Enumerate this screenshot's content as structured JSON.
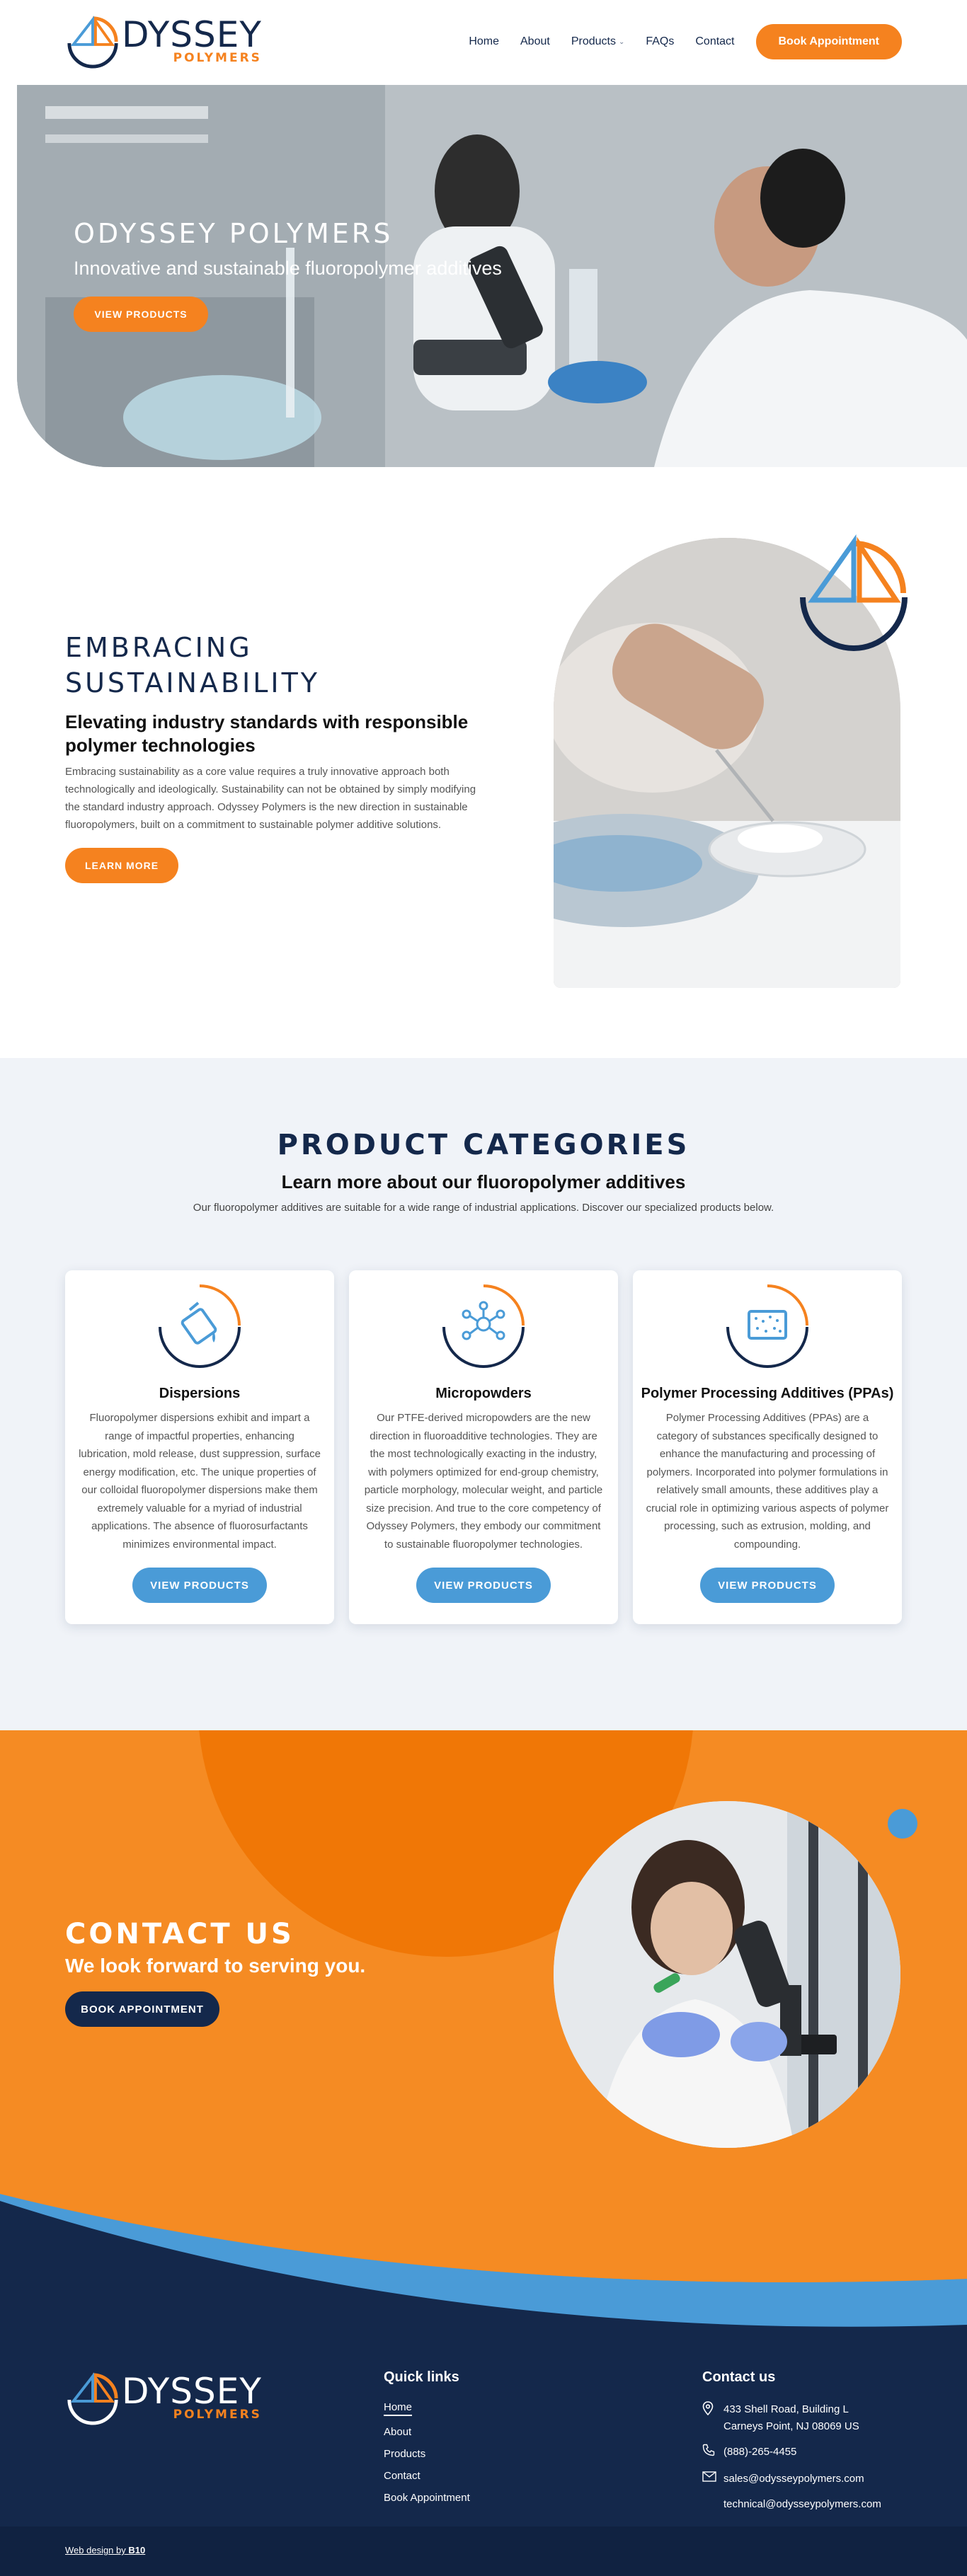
{
  "brand": {
    "word": "DYSSEY",
    "sub": "POLYMERS",
    "orange": "#f5821f",
    "navy": "#14284b",
    "blue": "#4a9bd7"
  },
  "nav": {
    "items": [
      "Home",
      "About",
      "Products",
      "FAQs",
      "Contact"
    ],
    "cta": "Book Appointment"
  },
  "hero": {
    "title": "ODYSSEY POLYMERS",
    "subtitle": "Innovative and sustainable fluoropolymer additives",
    "button": "VIEW PRODUCTS"
  },
  "sustainability": {
    "title_line1": "EMBRACING",
    "title_line2": "SUSTAINABILITY",
    "subtitle": "Elevating industry standards with responsible polymer technologies",
    "body": "Embracing sustainability as a core value requires a truly innovative approach both technologically and ideologically. Sustainability can not be obtained by simply modifying the standard industry approach. Odyssey Polymers is the new direction in sustainable fluoropolymers, built on a commitment to sustainable polymer additive solutions.",
    "button": "LEARN MORE"
  },
  "products": {
    "title": "PRODUCT CATEGORIES",
    "subtitle": "Learn more about our fluoropolymer additives",
    "description": "Our fluoropolymer additives are suitable for a wide range of industrial applications. Discover our specialized products below.",
    "cards": [
      {
        "icon": "dispersion-icon",
        "title": "Dispersions",
        "body": "Fluoropolymer dispersions exhibit and impart a range of impactful properties, enhancing lubrication, mold release, dust suppression, surface energy modification, etc. The unique properties of our colloidal fluoropolymer dispersions make them extremely valuable for a myriad of industrial applications. The absence of fluorosurfactants minimizes environmental impact.",
        "button": "VIEW PRODUCTS"
      },
      {
        "icon": "molecule-icon",
        "title": "Micropowders",
        "body": "Our PTFE-derived micropowders are the new direction in fluoroadditive technologies. They are the most technologically exacting in the industry, with polymers optimized for end-group chemistry, particle morphology, molecular weight, and particle size precision. And true to the core competency of Odyssey Polymers, they embody our commitment to sustainable fluoropolymer technologies.",
        "button": "VIEW PRODUCTS"
      },
      {
        "icon": "processing-additive-icon",
        "title": "Polymer Processing Additives (PPAs)",
        "body": "Polymer Processing Additives (PPAs) are a category of substances specifically designed to enhance the manufacturing and processing of polymers. Incorporated into polymer formulations in relatively small amounts, these additives play a crucial role in optimizing various aspects of polymer processing, such as extrusion, molding, and compounding.",
        "button": "VIEW PRODUCTS"
      }
    ]
  },
  "contact": {
    "title": "CONTACT US",
    "subtitle": "We look forward to serving you.",
    "button": "BOOK APPOINTMENT"
  },
  "footer": {
    "quick_links_title": "Quick links",
    "quick_links": [
      "Home",
      "About",
      "Products",
      "Contact",
      "Book Appointment"
    ],
    "contact_title": "Contact us",
    "address_line1": "433 Shell Road, Building L",
    "address_line2": "Carneys Point, NJ 08069 US",
    "phone": "(888)-265-4455",
    "email1": "sales@odysseypolymers.com",
    "email2": "technical@odysseypolymers.com",
    "credit": "Web design by",
    "credit_brand": "B10"
  }
}
